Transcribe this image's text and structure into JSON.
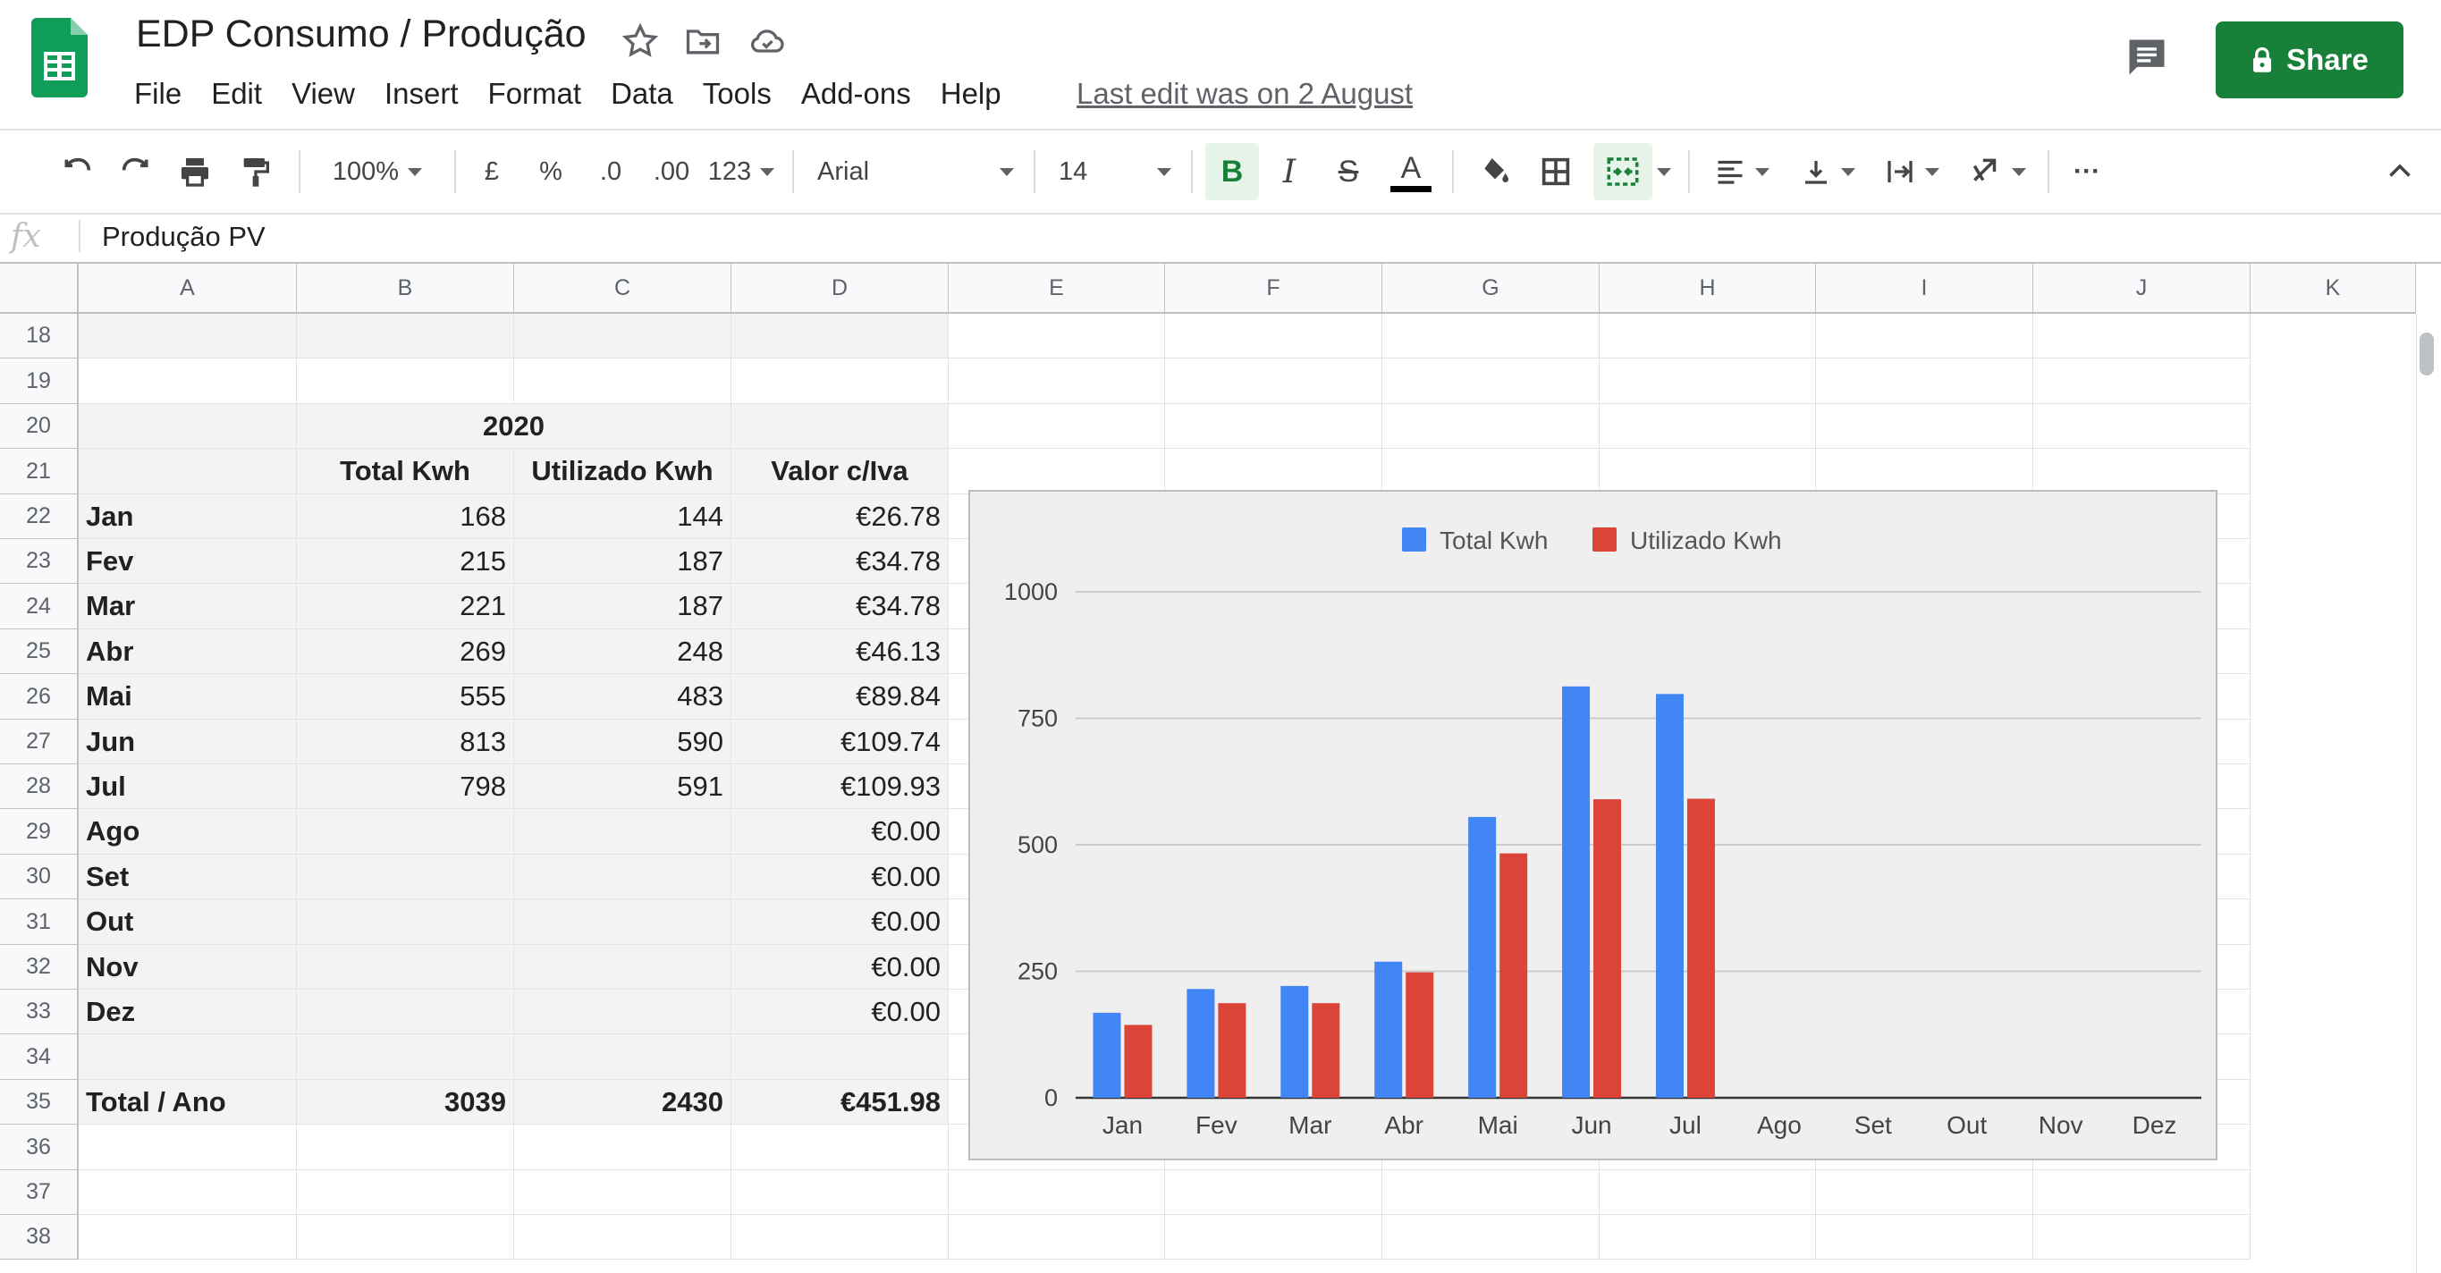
{
  "app": {
    "doc_title": "EDP Consumo / Produção",
    "menu": [
      "File",
      "Edit",
      "View",
      "Insert",
      "Format",
      "Data",
      "Tools",
      "Add-ons",
      "Help"
    ],
    "last_edit": "Last edit was on 2 August",
    "share_label": "Share"
  },
  "toolbar": {
    "zoom": "100%",
    "currency": "£",
    "percent": "%",
    "dec_less": ".0",
    "dec_more": ".00",
    "more_formats": "123",
    "font": "Arial",
    "font_size": "14",
    "bold": "B",
    "italic": "I",
    "strike": "S",
    "text_color": "A",
    "more": "···"
  },
  "formula_bar": {
    "fx": "fx",
    "value": "Produção PV"
  },
  "columns": [
    "A",
    "B",
    "C",
    "D",
    "E",
    "F",
    "G",
    "H",
    "I",
    "J",
    "K"
  ],
  "rows": [
    {
      "num": "18",
      "cells": [
        "",
        "",
        "",
        ""
      ]
    },
    {
      "num": "19",
      "cells": [
        "",
        "",
        "",
        ""
      ]
    },
    {
      "num": "20",
      "cells": [
        "",
        "2020",
        "",
        ""
      ]
    },
    {
      "num": "21",
      "cells": [
        "",
        "Total Kwh",
        "Utilizado Kwh",
        "Valor c/Iva"
      ]
    },
    {
      "num": "22",
      "cells": [
        "Jan",
        "168",
        "144",
        "€26.78"
      ]
    },
    {
      "num": "23",
      "cells": [
        "Fev",
        "215",
        "187",
        "€34.78"
      ]
    },
    {
      "num": "24",
      "cells": [
        "Mar",
        "221",
        "187",
        "€34.78"
      ]
    },
    {
      "num": "25",
      "cells": [
        "Abr",
        "269",
        "248",
        "€46.13"
      ]
    },
    {
      "num": "26",
      "cells": [
        "Mai",
        "555",
        "483",
        "€89.84"
      ]
    },
    {
      "num": "27",
      "cells": [
        "Jun",
        "813",
        "590",
        "€109.74"
      ]
    },
    {
      "num": "28",
      "cells": [
        "Jul",
        "798",
        "591",
        "€109.93"
      ]
    },
    {
      "num": "29",
      "cells": [
        "Ago",
        "",
        "",
        "€0.00"
      ]
    },
    {
      "num": "30",
      "cells": [
        "Set",
        "",
        "",
        "€0.00"
      ]
    },
    {
      "num": "31",
      "cells": [
        "Out",
        "",
        "",
        "€0.00"
      ]
    },
    {
      "num": "32",
      "cells": [
        "Nov",
        "",
        "",
        "€0.00"
      ]
    },
    {
      "num": "33",
      "cells": [
        "Dez",
        "",
        "",
        "€0.00"
      ]
    },
    {
      "num": "34",
      "cells": [
        "",
        "",
        "",
        ""
      ]
    },
    {
      "num": "35",
      "cells": [
        "Total / Ano",
        "3039",
        "2430",
        "€451.98"
      ]
    },
    {
      "num": "36",
      "cells": [
        "",
        "",
        "",
        ""
      ]
    },
    {
      "num": "37",
      "cells": [
        "",
        "",
        "",
        ""
      ]
    },
    {
      "num": "38",
      "cells": [
        "",
        "",
        "",
        ""
      ]
    }
  ],
  "chart_data": {
    "type": "bar",
    "categories": [
      "Jan",
      "Fev",
      "Mar",
      "Abr",
      "Mai",
      "Jun",
      "Jul",
      "Ago",
      "Set",
      "Out",
      "Nov",
      "Dez"
    ],
    "series": [
      {
        "name": "Total Kwh",
        "color": "#4285f4",
        "values": [
          168,
          215,
          221,
          269,
          555,
          813,
          798,
          null,
          null,
          null,
          null,
          null
        ]
      },
      {
        "name": "Utilizado Kwh",
        "color": "#db4437",
        "values": [
          144,
          187,
          187,
          248,
          483,
          590,
          591,
          null,
          null,
          null,
          null,
          null
        ]
      }
    ],
    "ylim": [
      0,
      1000
    ],
    "yticks": [
      0,
      250,
      500,
      750,
      1000
    ],
    "legend": "top",
    "grid": true
  },
  "colors": {
    "share_green": "#188038",
    "sheets_green": "#0f9d58",
    "bold_active_bg": "#e6f4ea"
  }
}
